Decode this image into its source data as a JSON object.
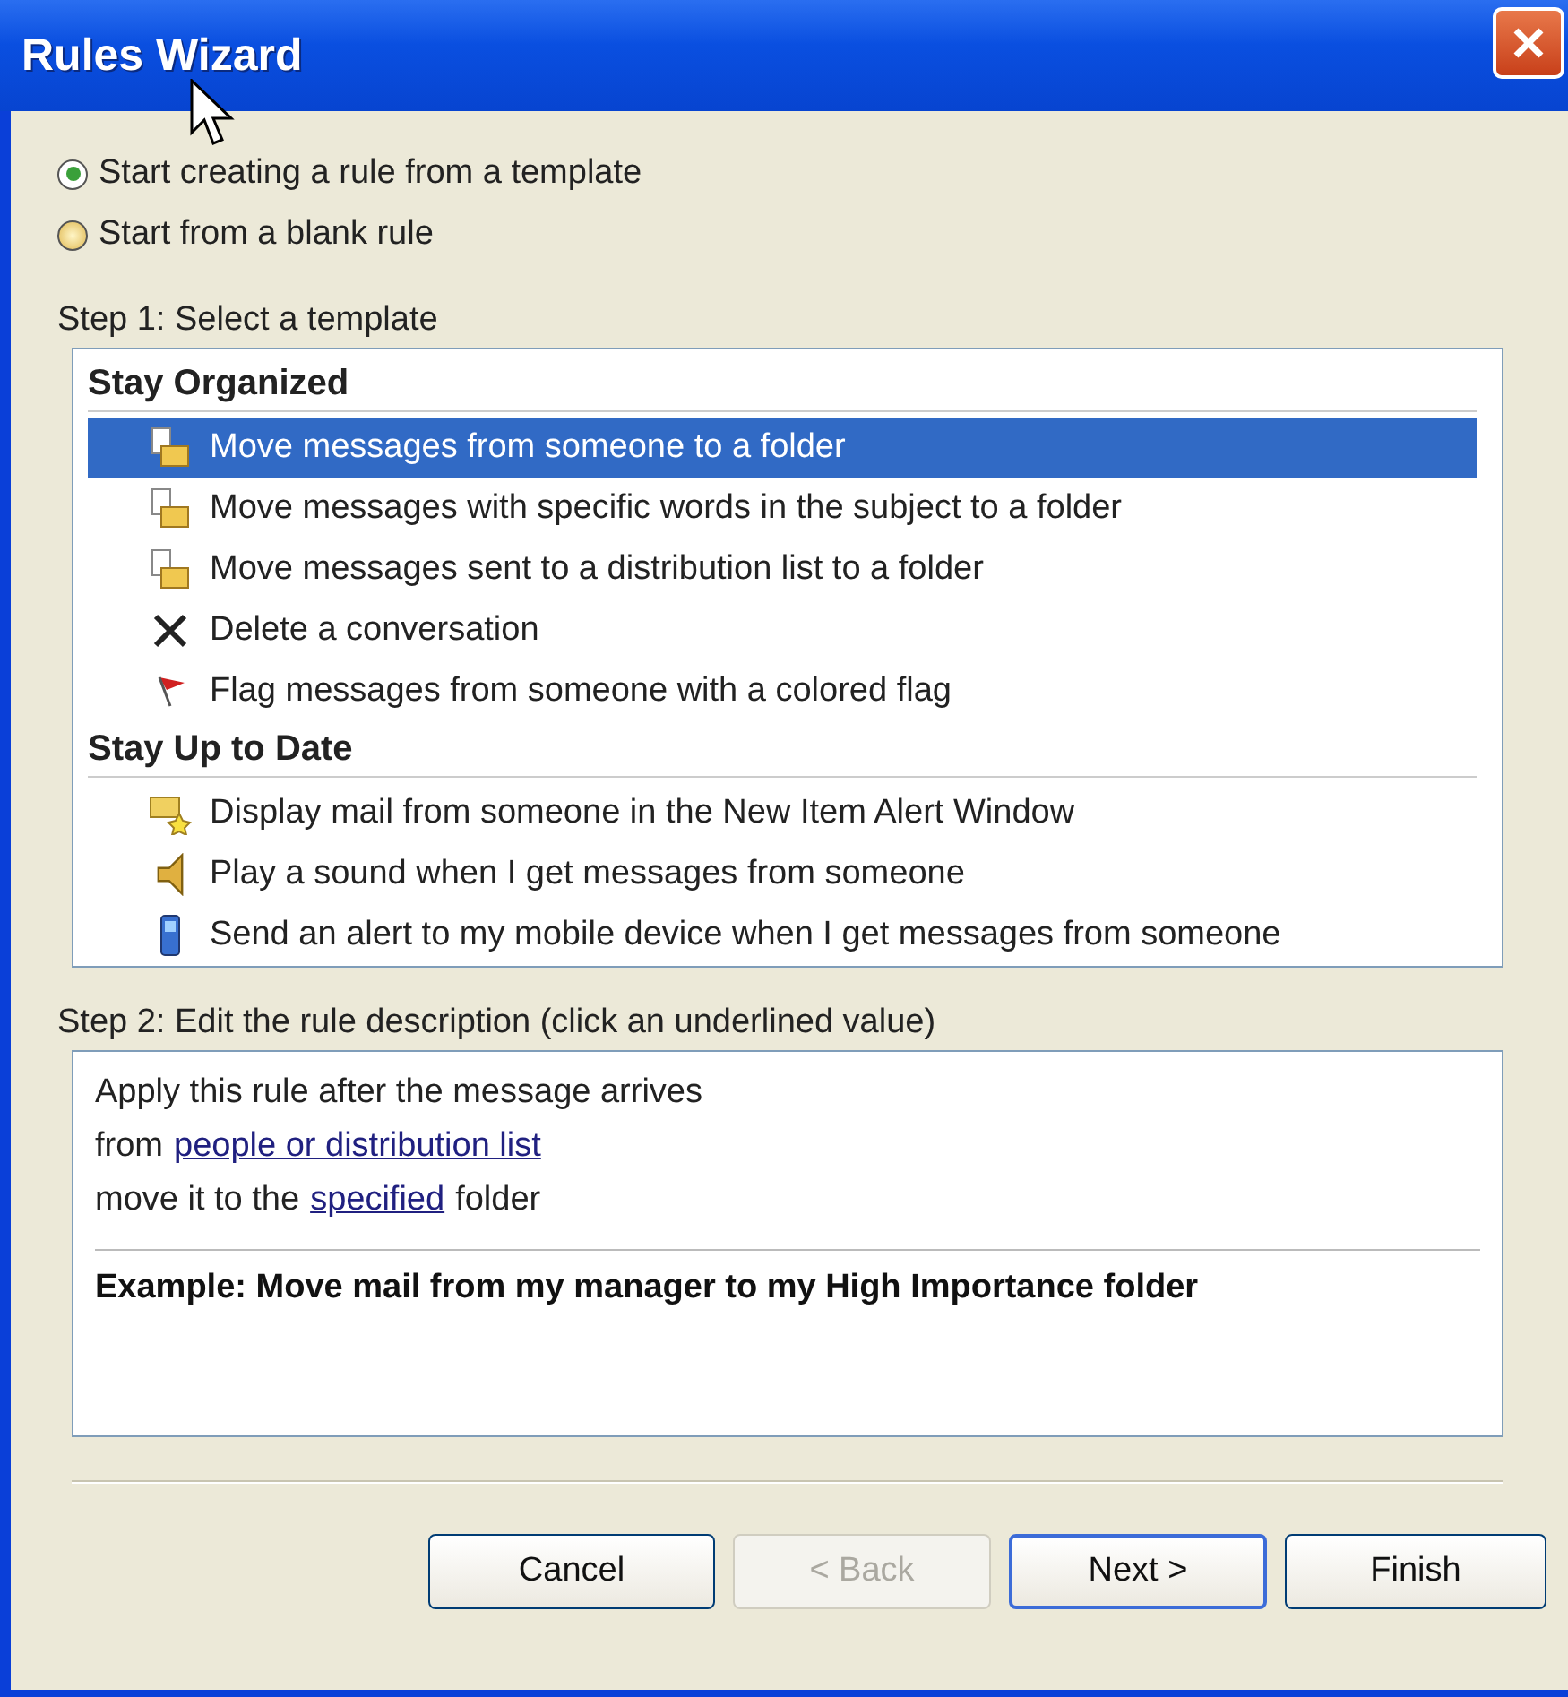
{
  "window": {
    "title": "Rules Wizard"
  },
  "options": [
    {
      "label": "Start creating a rule from a template",
      "selected": true
    },
    {
      "label": "Start from a blank rule",
      "selected": false
    }
  ],
  "step1": {
    "label": "Step 1: Select a template",
    "groups": [
      {
        "heading": "Stay Organized",
        "items": [
          {
            "label": "Move messages from someone to a folder",
            "kind": "move",
            "selected": true
          },
          {
            "label": "Move messages with specific words in the subject to a folder",
            "kind": "move",
            "selected": false
          },
          {
            "label": "Move messages sent to a distribution list to a folder",
            "kind": "move",
            "selected": false
          },
          {
            "label": "Delete a conversation",
            "kind": "delete",
            "selected": false
          },
          {
            "label": "Flag messages from someone with a colored flag",
            "kind": "flag",
            "selected": false
          }
        ]
      },
      {
        "heading": "Stay Up to Date",
        "items": [
          {
            "label": "Display mail from someone in the New Item Alert Window",
            "kind": "alert",
            "selected": false
          },
          {
            "label": "Play a sound when I get messages from someone",
            "kind": "sound",
            "selected": false
          },
          {
            "label": "Send an alert to my mobile device when I get messages from someone",
            "kind": "mobile",
            "selected": false
          }
        ]
      }
    ]
  },
  "step2": {
    "label": "Step 2: Edit the rule description (click an underlined value)",
    "lines": [
      [
        {
          "kind": "text",
          "text": "Apply this rule after the message arrives"
        }
      ],
      [
        {
          "kind": "text",
          "text": "from"
        },
        {
          "kind": "link",
          "text": "people or distribution list"
        }
      ],
      [
        {
          "kind": "text",
          "text": "move it to the"
        },
        {
          "kind": "link",
          "text": "specified"
        },
        {
          "kind": "text",
          "text": "folder"
        }
      ]
    ],
    "example": "Example: Move mail from my manager to my High Importance folder"
  },
  "buttons": [
    {
      "label": "Cancel",
      "disabled": false,
      "default": false
    },
    {
      "label": "< Back",
      "disabled": true,
      "default": false
    },
    {
      "label": "Next >",
      "disabled": false,
      "default": true
    },
    {
      "label": "Finish",
      "disabled": false,
      "default": false
    }
  ]
}
